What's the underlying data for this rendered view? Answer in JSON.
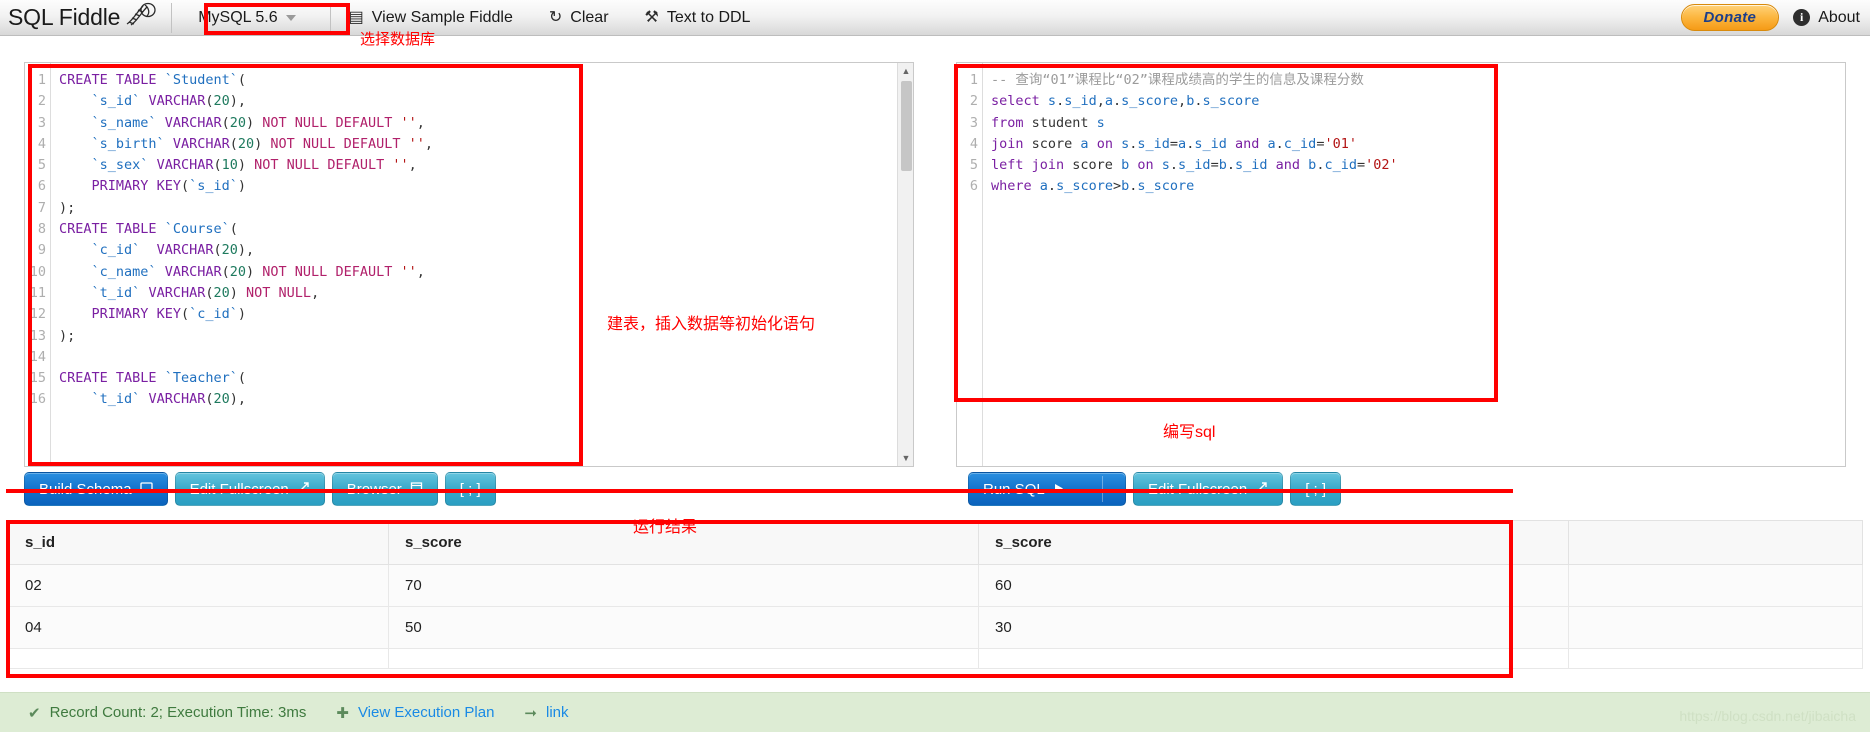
{
  "app": {
    "brand": "SQL Fiddle",
    "brand_icon": "dna-helix-icon"
  },
  "topnav": {
    "db_select": {
      "label": "MySQL 5.6",
      "icon": "chevron-down-icon"
    },
    "items": [
      {
        "label": "View Sample Fiddle",
        "icon": "document-icon",
        "glyph": "▤"
      },
      {
        "label": "Clear",
        "icon": "refresh-icon",
        "glyph": "↻"
      },
      {
        "label": "Text to DDL",
        "icon": "wrench-icon",
        "glyph": "⚒"
      }
    ],
    "donate_label": "Donate",
    "about_label": "About",
    "about_icon": "info-icon"
  },
  "annotations": {
    "db_select": "选择数据库",
    "schema_panel": "建表，插入数据等初始化语句",
    "query_panel": "编写sql",
    "results": "运行结果",
    "color": "#ff0000"
  },
  "schema_editor": {
    "name": "schema-sql-editor",
    "line_numbers": [
      "1",
      "2",
      "3",
      "4",
      "5",
      "6",
      "7",
      "8",
      "9",
      "10",
      "11",
      "12",
      "13",
      "14",
      "15",
      "16"
    ],
    "lines": [
      "CREATE TABLE `Student`(",
      "    `s_id` VARCHAR(20),",
      "    `s_name` VARCHAR(20) NOT NULL DEFAULT '',",
      "    `s_birth` VARCHAR(20) NOT NULL DEFAULT '',",
      "    `s_sex` VARCHAR(10) NOT NULL DEFAULT '',",
      "    PRIMARY KEY(`s_id`)",
      ");",
      "CREATE TABLE `Course`(",
      "    `c_id`  VARCHAR(20),",
      "    `c_name` VARCHAR(20) NOT NULL DEFAULT '',",
      "    `t_id` VARCHAR(20) NOT NULL,",
      "    PRIMARY KEY(`c_id`)",
      ");",
      "",
      "CREATE TABLE `Teacher`(",
      "    `t_id` VARCHAR(20),"
    ]
  },
  "query_editor": {
    "name": "query-sql-editor",
    "line_numbers": [
      "1",
      "2",
      "3",
      "4",
      "5",
      "6"
    ],
    "lines": [
      "-- 查询“01”课程比“02”课程成绩高的学生的信息及课程分数",
      "select s.s_id,a.s_score,b.s_score",
      "from student s",
      "join score a on s.s_id=a.s_id and a.c_id='01'",
      "left join score b on s.s_id=b.s_id and b.c_id='02'",
      "where a.s_score>b.s_score"
    ]
  },
  "left_buttons": [
    {
      "label": "Build Schema",
      "icon": "database-icon",
      "glyph": "🖥",
      "style": "primary"
    },
    {
      "label": "Edit Fullscreen",
      "icon": "expand-icon",
      "glyph": "⤢",
      "style": "teal"
    },
    {
      "label": "Browser",
      "icon": "window-icon",
      "glyph": "☰",
      "style": "teal"
    },
    {
      "label": "[ ; ]",
      "icon": "separator-icon",
      "glyph": "",
      "style": "teal"
    }
  ],
  "right_buttons": [
    {
      "label": "Run SQL",
      "icon": "play-icon",
      "glyph": "▶",
      "style": "primary"
    },
    {
      "label": "Edit Fullscreen",
      "icon": "expand-icon",
      "glyph": "⤢",
      "style": "teal"
    },
    {
      "label": "[ ; ]",
      "icon": "separator-icon",
      "glyph": "",
      "style": "teal"
    }
  ],
  "results": {
    "columns": [
      "s_id",
      "s_score",
      "s_score"
    ],
    "rows": [
      [
        "02",
        "70",
        "60"
      ],
      [
        "04",
        "50",
        "30"
      ]
    ]
  },
  "statusbar": {
    "record_info": "Record Count: 2; Execution Time: 3ms",
    "check_icon": "check-icon",
    "exec_plan_label": "View Execution Plan",
    "exec_plan_icon": "plus-icon",
    "link_label": "link",
    "link_icon": "arrow-icon",
    "watermark": "https://blog.csdn.net/jibaicha"
  }
}
